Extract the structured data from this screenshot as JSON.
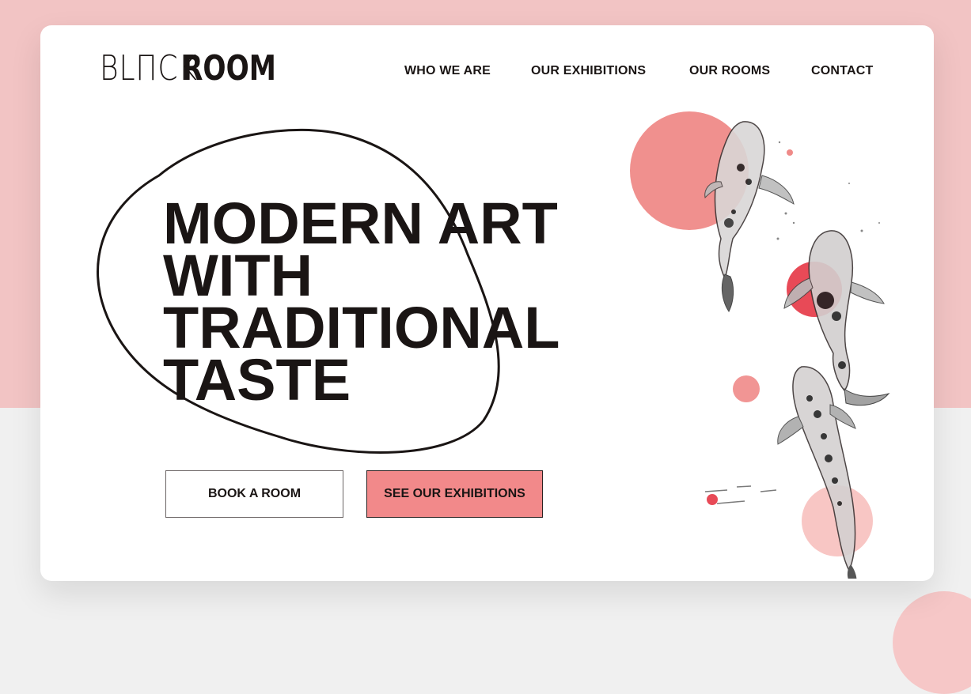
{
  "brand": {
    "logo_thin": "BLΠCK",
    "logo_bold": "ROOM"
  },
  "nav": {
    "items": [
      {
        "label": "WHO WE ARE"
      },
      {
        "label": "OUR EXHIBITIONS"
      },
      {
        "label": "OUR ROOMS"
      },
      {
        "label": "CONTACT"
      }
    ]
  },
  "hero": {
    "headline_lines": [
      "MODERN ART",
      "WITH",
      "TRADITIONAL",
      "TASTE"
    ]
  },
  "actions": {
    "book_label": "BOOK A ROOM",
    "exhibitions_label": "SEE OUR EXHIBITIONS"
  },
  "colors": {
    "page_pink": "#f2c4c4",
    "accent_coral": "#f2898a",
    "accent_red": "#e84a57",
    "ink": "#1a1514"
  }
}
